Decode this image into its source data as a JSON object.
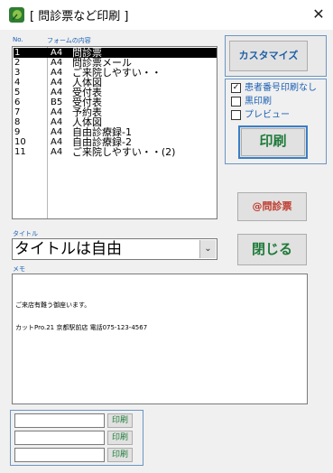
{
  "window": {
    "title": "[ 問診票など印刷 ]"
  },
  "labels": {
    "no": "No.",
    "form_content": "フォームの内容",
    "title": "タイトル",
    "memo": "メモ"
  },
  "forms": [
    {
      "no": "1",
      "size": "A4",
      "name": "問診票",
      "selected": true
    },
    {
      "no": "2",
      "size": "A4",
      "name": "問診票メール"
    },
    {
      "no": "3",
      "size": "A4",
      "name": "ご来院しやすい・・"
    },
    {
      "no": "4",
      "size": "A4",
      "name": "人体図"
    },
    {
      "no": "5",
      "size": "A4",
      "name": "受付表"
    },
    {
      "no": "6",
      "size": "B5",
      "name": "受付表"
    },
    {
      "no": "7",
      "size": "A4",
      "name": "予約表"
    },
    {
      "no": "8",
      "size": "A4",
      "name": "人体図"
    },
    {
      "no": "9",
      "size": "A4",
      "name": "自由診療録-1"
    },
    {
      "no": "10",
      "size": "A4",
      "name": "自由診療録-2"
    },
    {
      "no": "11",
      "size": "A4",
      "name": "ご来院しやすい・・(2)"
    }
  ],
  "buttons": {
    "customize": "カスタマイズ",
    "print": "印刷",
    "monshinhyo": "@問診票",
    "close": "閉じる",
    "small_print": "印刷"
  },
  "options": [
    {
      "label": "患者番号印刷なし",
      "checked": true
    },
    {
      "label": "黒印刷",
      "checked": false
    },
    {
      "label": "プレビュー",
      "checked": false
    }
  ],
  "title_select": {
    "value": "タイトルは自由"
  },
  "memo": {
    "line1": "ご来店有難う御座います。",
    "line2": "カットPro.21  京都駅前店  電話075-123-4567"
  },
  "bottom_inputs": [
    {
      "value": ""
    },
    {
      "value": ""
    },
    {
      "value": ""
    }
  ],
  "icons": {
    "app": "app-leaf-icon",
    "close": "close-icon",
    "check": "✓",
    "dropdown": "⌄"
  }
}
